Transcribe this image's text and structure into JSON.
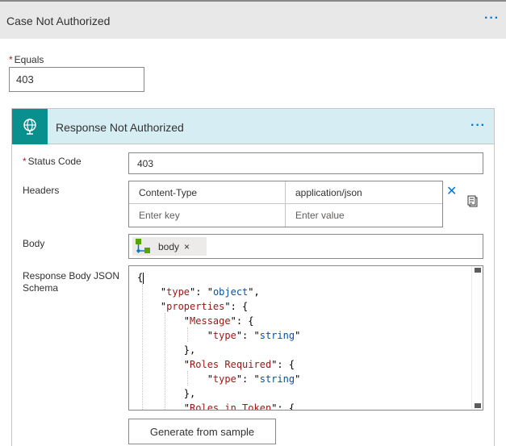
{
  "case": {
    "title": "Case Not Authorized",
    "more": "···"
  },
  "equals": {
    "required": "*",
    "label": "Equals",
    "value": "403"
  },
  "action": {
    "title": "Response Not Authorized",
    "more": "···",
    "icon": "globe-response-icon",
    "accent": "#0a8f8f"
  },
  "status_code": {
    "required": "*",
    "label": "Status Code",
    "value": "403"
  },
  "headers": {
    "label": "Headers",
    "rows": [
      {
        "key": "Content-Type",
        "value": "application/json"
      },
      {
        "key_placeholder": "Enter key",
        "value_placeholder": "Enter value"
      }
    ],
    "remove": "✕"
  },
  "body": {
    "label": "Body",
    "token": "body",
    "token_remove": "×"
  },
  "schema": {
    "label": "Response Body JSON Schema"
  },
  "generate_button": "Generate from sample"
}
